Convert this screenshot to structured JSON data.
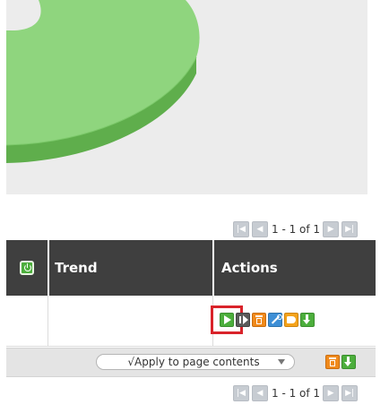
{
  "pager_top": {
    "text": "1 - 1 of 1"
  },
  "table": {
    "columns": [
      {
        "label": ""
      },
      {
        "label": "Trend"
      },
      {
        "label": "Actions"
      }
    ]
  },
  "bulk": {
    "select_value": "√Apply to page contents"
  },
  "pager_bottom": {
    "text": "1 - 1 of 1"
  },
  "colors": {
    "header_bg": "#3f3f3f",
    "ring_light": "#8dd47c",
    "ring_dark": "#5fae4c",
    "panel_bg": "#ececec",
    "highlight": "#d9232a"
  }
}
